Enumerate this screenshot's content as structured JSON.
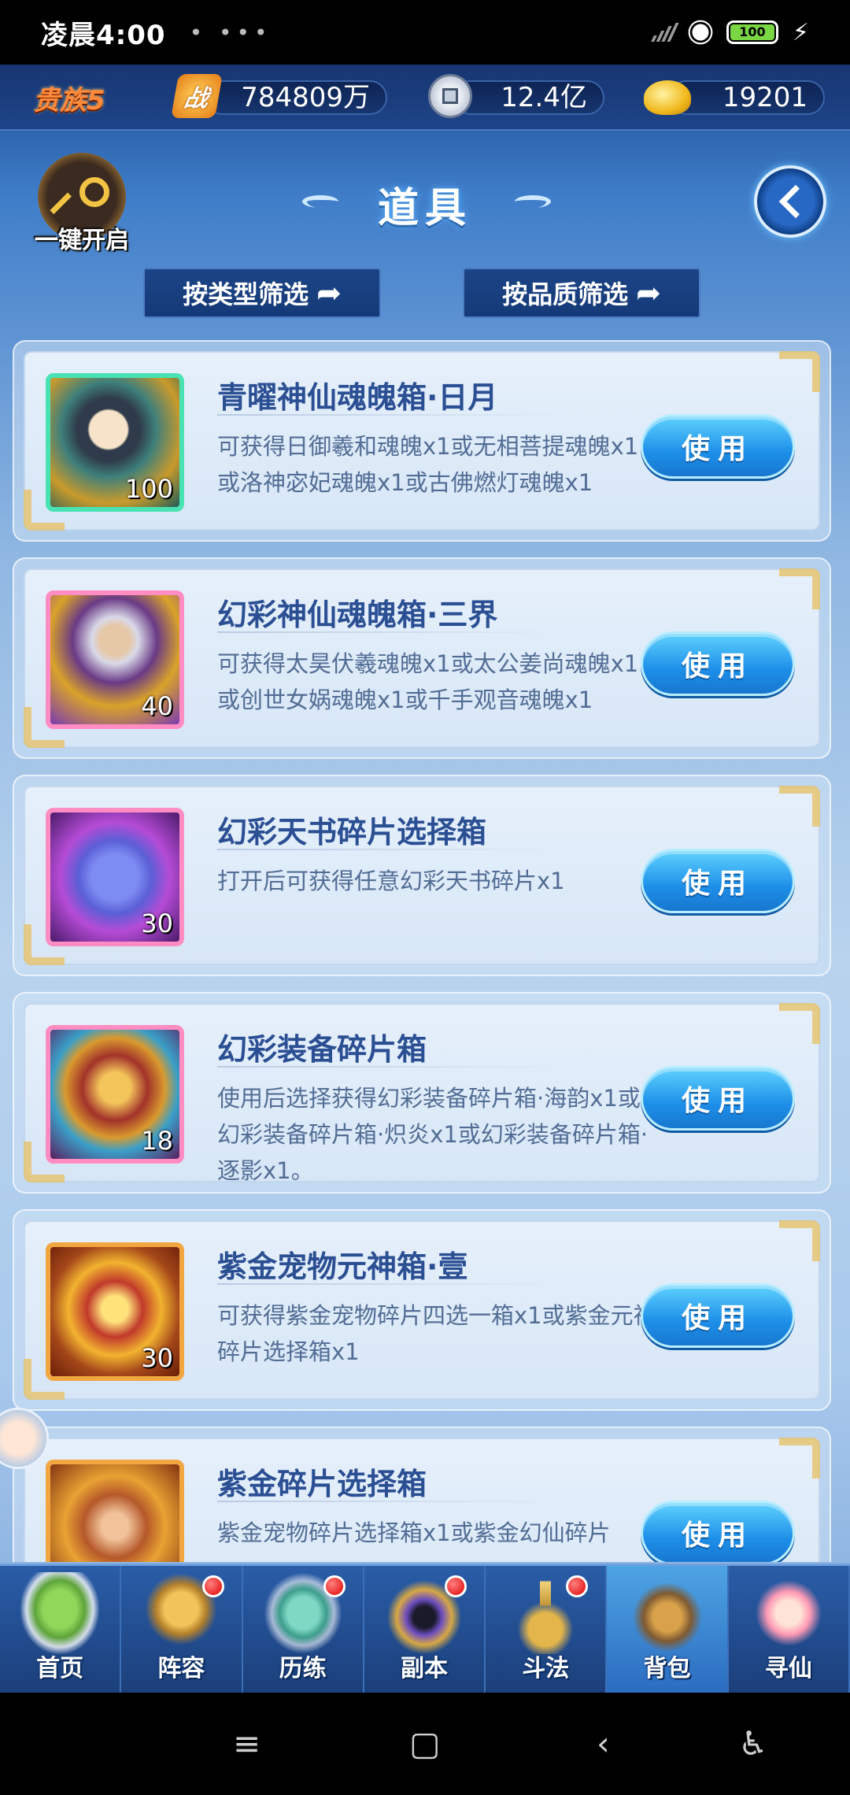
{
  "status_bar": {
    "time": "凌晨4:00",
    "dots": "• •••",
    "battery": "100",
    "bolt": "⚡"
  },
  "resources": {
    "noble": "贵族5",
    "power_icon_text": "战",
    "power": "784809万",
    "coins": "12.4亿",
    "ingots": "19201"
  },
  "header": {
    "one_key_open": "一键开启",
    "title": "道具",
    "filter_type": "按类型筛选",
    "filter_quality": "按品质筛选"
  },
  "items": [
    {
      "name": "青曜神仙魂魄箱·日月",
      "desc": "可获得日御羲和魂魄x1或无相菩提魂魄x1或洛神宓妃魂魄x1或古佛燃灯魂魄x1",
      "count": "100",
      "use_label": "使用"
    },
    {
      "name": "幻彩神仙魂魄箱·三界",
      "desc": "可获得太昊伏羲魂魄x1或太公姜尚魂魄x1或创世女娲魂魄x1或千手观音魂魄x1",
      "count": "40",
      "use_label": "使用"
    },
    {
      "name": "幻彩天书碎片选择箱",
      "desc": "打开后可获得任意幻彩天书碎片x1",
      "count": "30",
      "use_label": "使用"
    },
    {
      "name": "幻彩装备碎片箱",
      "desc": "使用后选择获得幻彩装备碎片箱·海韵x1或幻彩装备碎片箱·炽炎x1或幻彩装备碎片箱·逐影x1。",
      "count": "18",
      "use_label": "使用"
    },
    {
      "name": "紫金宠物元神箱·壹",
      "desc": "可获得紫金宠物碎片四选一箱x1或紫金元神碎片选择箱x1",
      "count": "30",
      "use_label": "使用"
    },
    {
      "name": "紫金碎片选择箱",
      "desc": "紫金宠物碎片选择箱x1或紫金幻仙碎片",
      "count": "",
      "use_label": "使用"
    }
  ],
  "nav": [
    {
      "label": "首页"
    },
    {
      "label": "阵容"
    },
    {
      "label": "历练"
    },
    {
      "label": "副本"
    },
    {
      "label": "斗法"
    },
    {
      "label": "背包"
    },
    {
      "label": "寻仙"
    }
  ],
  "android_nav": {
    "menu": "≡",
    "home": "▢",
    "back": "‹",
    "accessibility": "♿"
  }
}
